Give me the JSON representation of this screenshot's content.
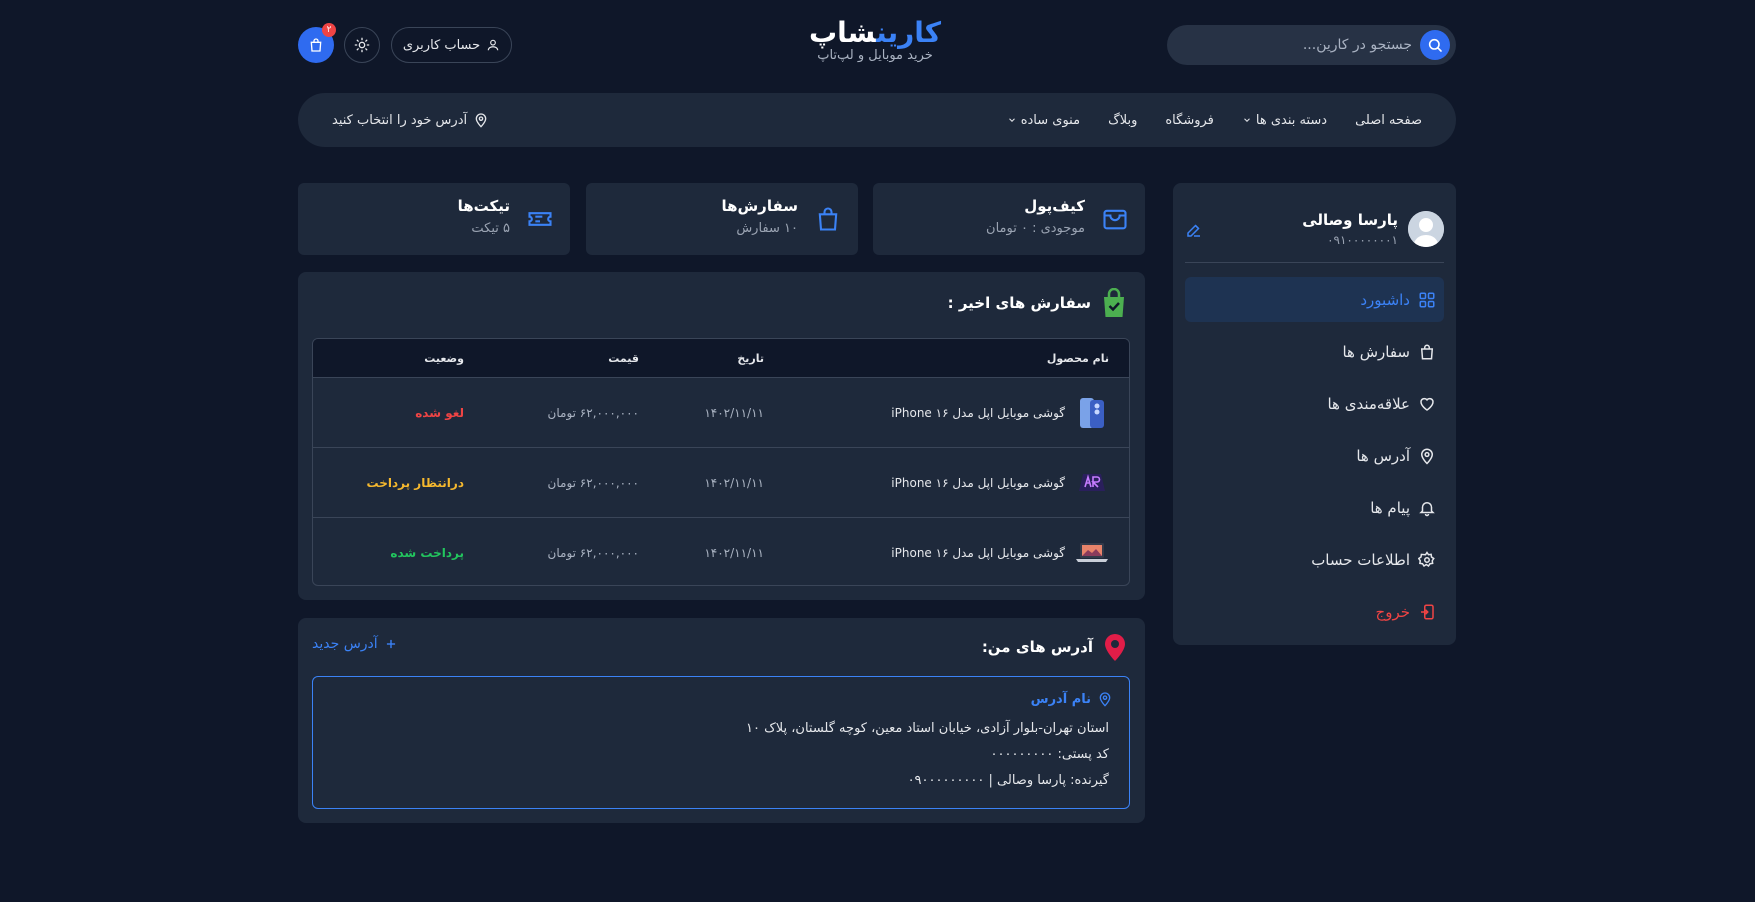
{
  "header": {
    "search_placeholder": "جستجو در کارین...",
    "logo_part1": "کارین",
    "logo_part2": "شاپ",
    "logo_subtitle": "خرید موبایل و لپ‌تاپ",
    "account_label": "حساب کاربری",
    "cart_count": "۲"
  },
  "nav": {
    "items": [
      {
        "label": "صفحه اصلی",
        "dropdown": false
      },
      {
        "label": "دسته بندی ها",
        "dropdown": true
      },
      {
        "label": "فروشگاه",
        "dropdown": false
      },
      {
        "label": "وبلاگ",
        "dropdown": false
      },
      {
        "label": "منوی ساده",
        "dropdown": true
      }
    ],
    "address_label": "آدرس خود را انتخاب کنید"
  },
  "profile": {
    "name": "پارسا وصالی",
    "phone": "۰۹۱۰۰۰۰۰۰۰۱"
  },
  "sidebar": {
    "items": [
      {
        "label": "داشبورد",
        "icon": "dashboard-icon"
      },
      {
        "label": "سفارش ها",
        "icon": "bag-icon"
      },
      {
        "label": "علاقه‌مندی ها",
        "icon": "heart-icon"
      },
      {
        "label": "آدرس ها",
        "icon": "location-icon"
      },
      {
        "label": "پیام ها",
        "icon": "bell-icon"
      },
      {
        "label": "اطلاعات حساب",
        "icon": "gear-icon"
      },
      {
        "label": "خروج",
        "icon": "logout-icon"
      }
    ]
  },
  "stats": {
    "wallet": {
      "title": "کیف‌پول",
      "sub": "موجودی : ۰ تومان"
    },
    "orders": {
      "title": "سفارش‌ها",
      "sub": "۱۰ سفارش"
    },
    "tickets": {
      "title": "تیکت‌ها",
      "sub": "۵ تیکت"
    }
  },
  "recent_orders": {
    "title": "سفارش های اخیر :",
    "columns": {
      "name": "نام محصول",
      "date": "تاریخ",
      "price": "قیمت",
      "status": "وضعیت"
    },
    "rows": [
      {
        "name": "گوشی موبایل اپل مدل iPhone ۱۶",
        "date": "۱۴۰۲/۱۱/۱۱",
        "price": "۶۲,۰۰۰,۰۰۰ تومان",
        "status": "لغو شده",
        "status_color": "#ef4444"
      },
      {
        "name": "گوشی موبایل اپل مدل iPhone ۱۶",
        "date": "۱۴۰۲/۱۱/۱۱",
        "price": "۶۲,۰۰۰,۰۰۰ تومان",
        "status": "درانتظار پرداخت",
        "status_color": "#f5b82e"
      },
      {
        "name": "گوشی موبایل اپل مدل iPhone ۱۶",
        "date": "۱۴۰۲/۱۱/۱۱",
        "price": "۶۲,۰۰۰,۰۰۰ تومان",
        "status": "پرداخت شده",
        "status_color": "#22c55e"
      }
    ]
  },
  "addresses": {
    "title": "آدرس های من:",
    "new_label": "آدرس جدید",
    "card": {
      "name": "نام آدرس",
      "line": "استان تهران-بلوار آزادی، خیابان استاد معین، کوچه گلستان، پلاک ۱۰",
      "postal": "کد پستی: ۰۰۰۰۰۰۰۰۰",
      "recipient": "گیرنده: پارسا وصالی | ۰۹۰۰۰۰۰۰۰۰۰"
    }
  },
  "colors": {
    "background": "#0f1729",
    "panel": "#1e293b",
    "accent": "#3b82f6"
  }
}
